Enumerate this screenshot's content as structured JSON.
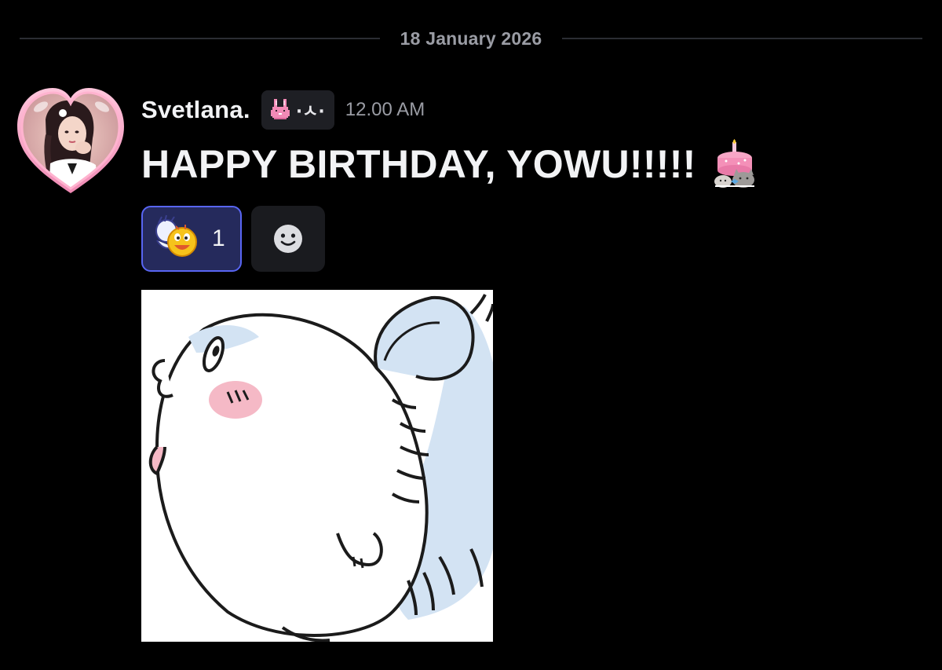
{
  "date_divider": {
    "text": "18 January 2026"
  },
  "message": {
    "author": "Svetlana.",
    "tag_text": "·ㅅ·",
    "tag_icon": "pink-bunny-icon",
    "timestamp": "12.00 AM",
    "text": "HAPPY BIRTHDAY, YOWU!!!!!",
    "text_emoji": "birthday-cake-icon",
    "reactions": [
      {
        "emoji": "waving-emoji-icon",
        "count": "1",
        "active": true
      }
    ],
    "add_reaction_icon": "smiley-icon",
    "attachment": {
      "kind": "image",
      "subject": "white hamster cartoon sticker"
    }
  },
  "colors": {
    "background": "#000000",
    "text_primary": "#f2f3f5",
    "text_muted": "#9a9ca4",
    "reaction_active_border": "#5865f2",
    "reaction_active_bg": "#252a5c"
  }
}
